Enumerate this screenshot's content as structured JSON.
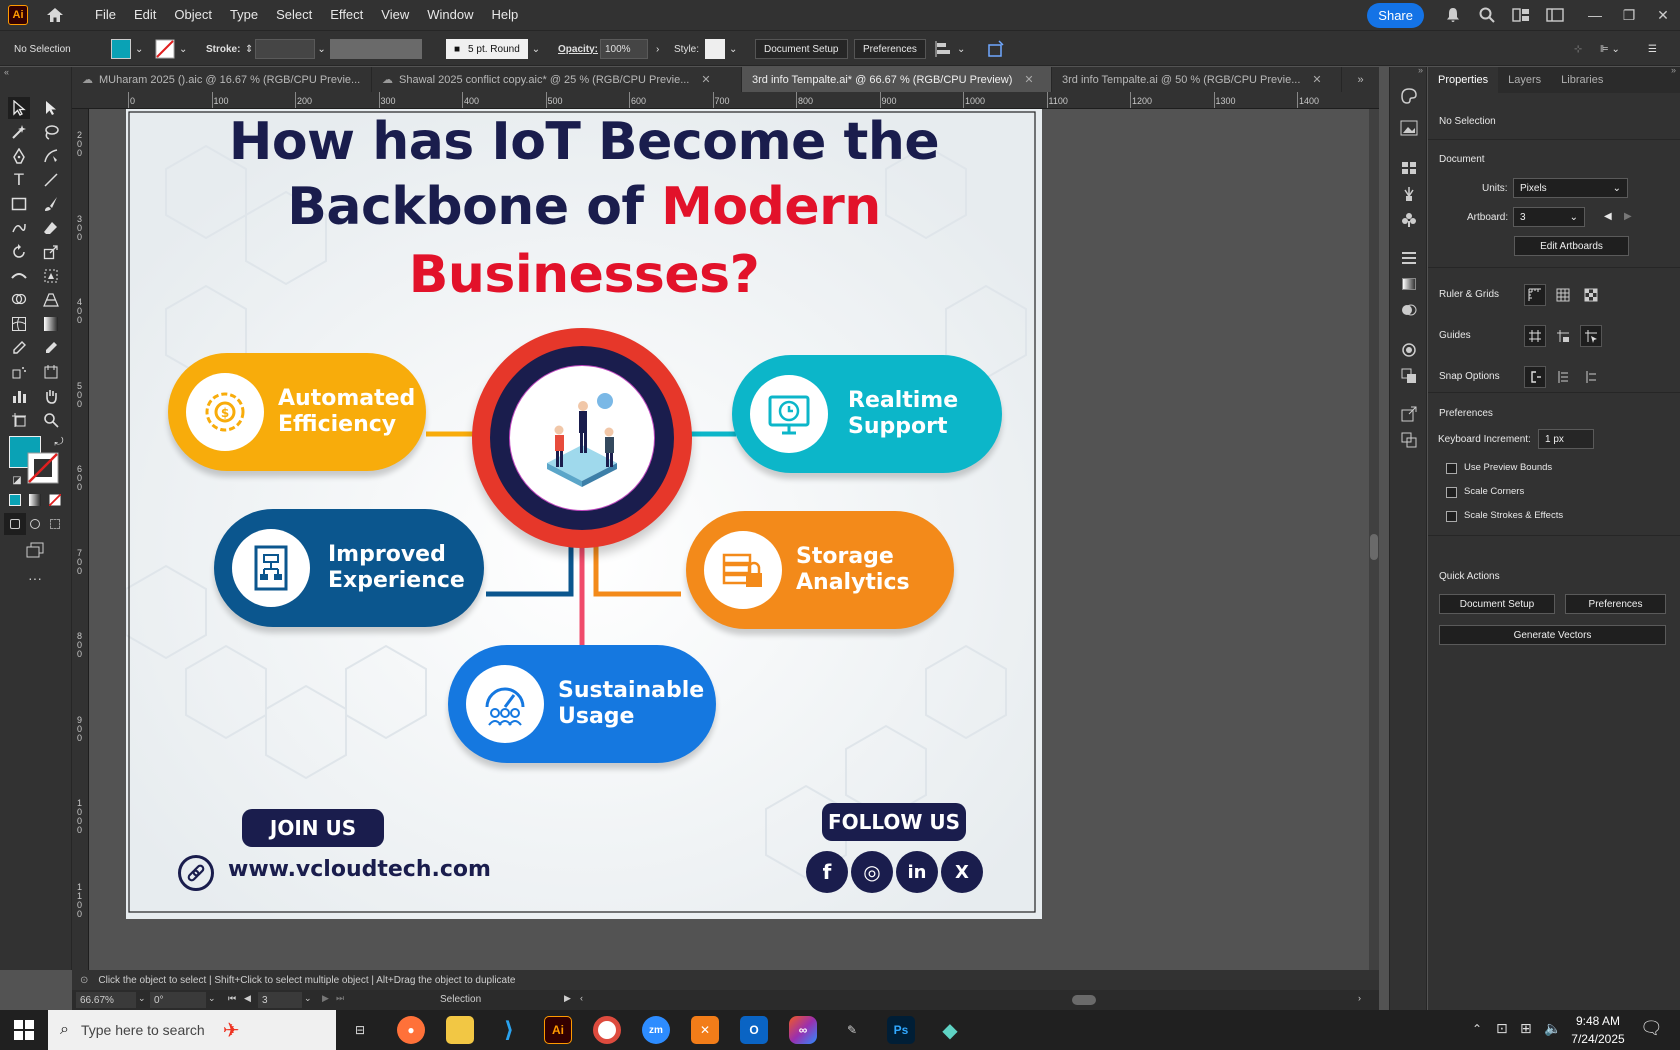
{
  "app": {
    "logo": "Ai",
    "menu": [
      "File",
      "Edit",
      "Object",
      "Type",
      "Select",
      "Effect",
      "View",
      "Window",
      "Help"
    ],
    "share_label": "Share"
  },
  "control_bar": {
    "selection": "No Selection",
    "stroke_label": "Stroke:",
    "brush": "5 pt. Round",
    "opacity_label": "Opacity:",
    "opacity_value": "100%",
    "style_label": "Style:",
    "document_setup": "Document Setup",
    "preferences": "Preferences",
    "fill_color": "#0aa2b5"
  },
  "tabs": [
    {
      "label": "MUharam 2025 ().aic @ 16.67 % (RGB/CPU Previe...",
      "active": false
    },
    {
      "label": "Shawal 2025 conflict copy.aic* @ 25 % (RGB/CPU Previe...",
      "active": false
    },
    {
      "label": "3rd info Tempalte.ai* @ 66.67 % (RGB/CPU Preview)",
      "active": true
    },
    {
      "label": "3rd info Tempalte.ai @ 50 % (RGB/CPU Previe...",
      "active": false
    }
  ],
  "ruler": {
    "h_ticks": [
      "0",
      "100",
      "200",
      "300",
      "400",
      "500",
      "600",
      "700",
      "800",
      "900",
      "1000",
      "1100",
      "1200",
      "1300",
      "1400"
    ],
    "v_ticks": [
      "2 0 0",
      "3 0 0",
      "4 0 0",
      "5 0 0",
      "6 0 0",
      "7 0 0",
      "8 0 0",
      "9 0 0",
      "1 0 0 0",
      "1 1 0 0"
    ]
  },
  "artboard": {
    "title_line1": "How has IoT Become the",
    "title_line2a": "Backbone of ",
    "title_line2b": "Modern",
    "title_line3": "Businesses?",
    "items": [
      {
        "line1": "Automated",
        "line2": "Efficiency",
        "color": "#f8ac0b"
      },
      {
        "line1": "Realtime",
        "line2": "Support",
        "color": "#0cb6c9"
      },
      {
        "line1": "Improved",
        "line2": "Experience",
        "color": "#0b568e"
      },
      {
        "line1": "Storage",
        "line2": "Analytics",
        "color": "#f38a1a"
      },
      {
        "line1": "Sustainable",
        "line2": "Usage",
        "color": "#1578e0"
      }
    ],
    "join_us": "JOIN US",
    "follow_us": "FOLLOW US",
    "website": "www.vcloudtech.com",
    "socials": [
      "f",
      "◎",
      "in",
      "X"
    ]
  },
  "properties": {
    "tabs": [
      "Properties",
      "Layers",
      "Libraries"
    ],
    "no_selection": "No Selection",
    "document": "Document",
    "units_label": "Units:",
    "units_value": "Pixels",
    "artboard_label": "Artboard:",
    "artboard_value": "3",
    "edit_artboards": "Edit Artboards",
    "ruler_grids": "Ruler & Grids",
    "guides": "Guides",
    "snap_options": "Snap Options",
    "preferences": "Preferences",
    "keyboard_increment_label": "Keyboard Increment:",
    "keyboard_increment_value": "1 px",
    "use_preview_bounds": "Use Preview Bounds",
    "scale_corners": "Scale Corners",
    "scale_strokes": "Scale Strokes & Effects",
    "quick_actions": "Quick Actions",
    "document_setup": "Document Setup",
    "preferences_btn": "Preferences",
    "generate_vectors": "Generate Vectors"
  },
  "status": {
    "hint": "Click the object to select  |  Shift+Click to select multiple object  |  Alt+Drag the object to duplicate",
    "zoom": "66.67%",
    "rotation": "0°",
    "artboard_num": "3",
    "mode": "Selection"
  },
  "taskbar": {
    "search_placeholder": "Type here to search",
    "time": "9:48 AM",
    "date": "7/24/2025"
  }
}
